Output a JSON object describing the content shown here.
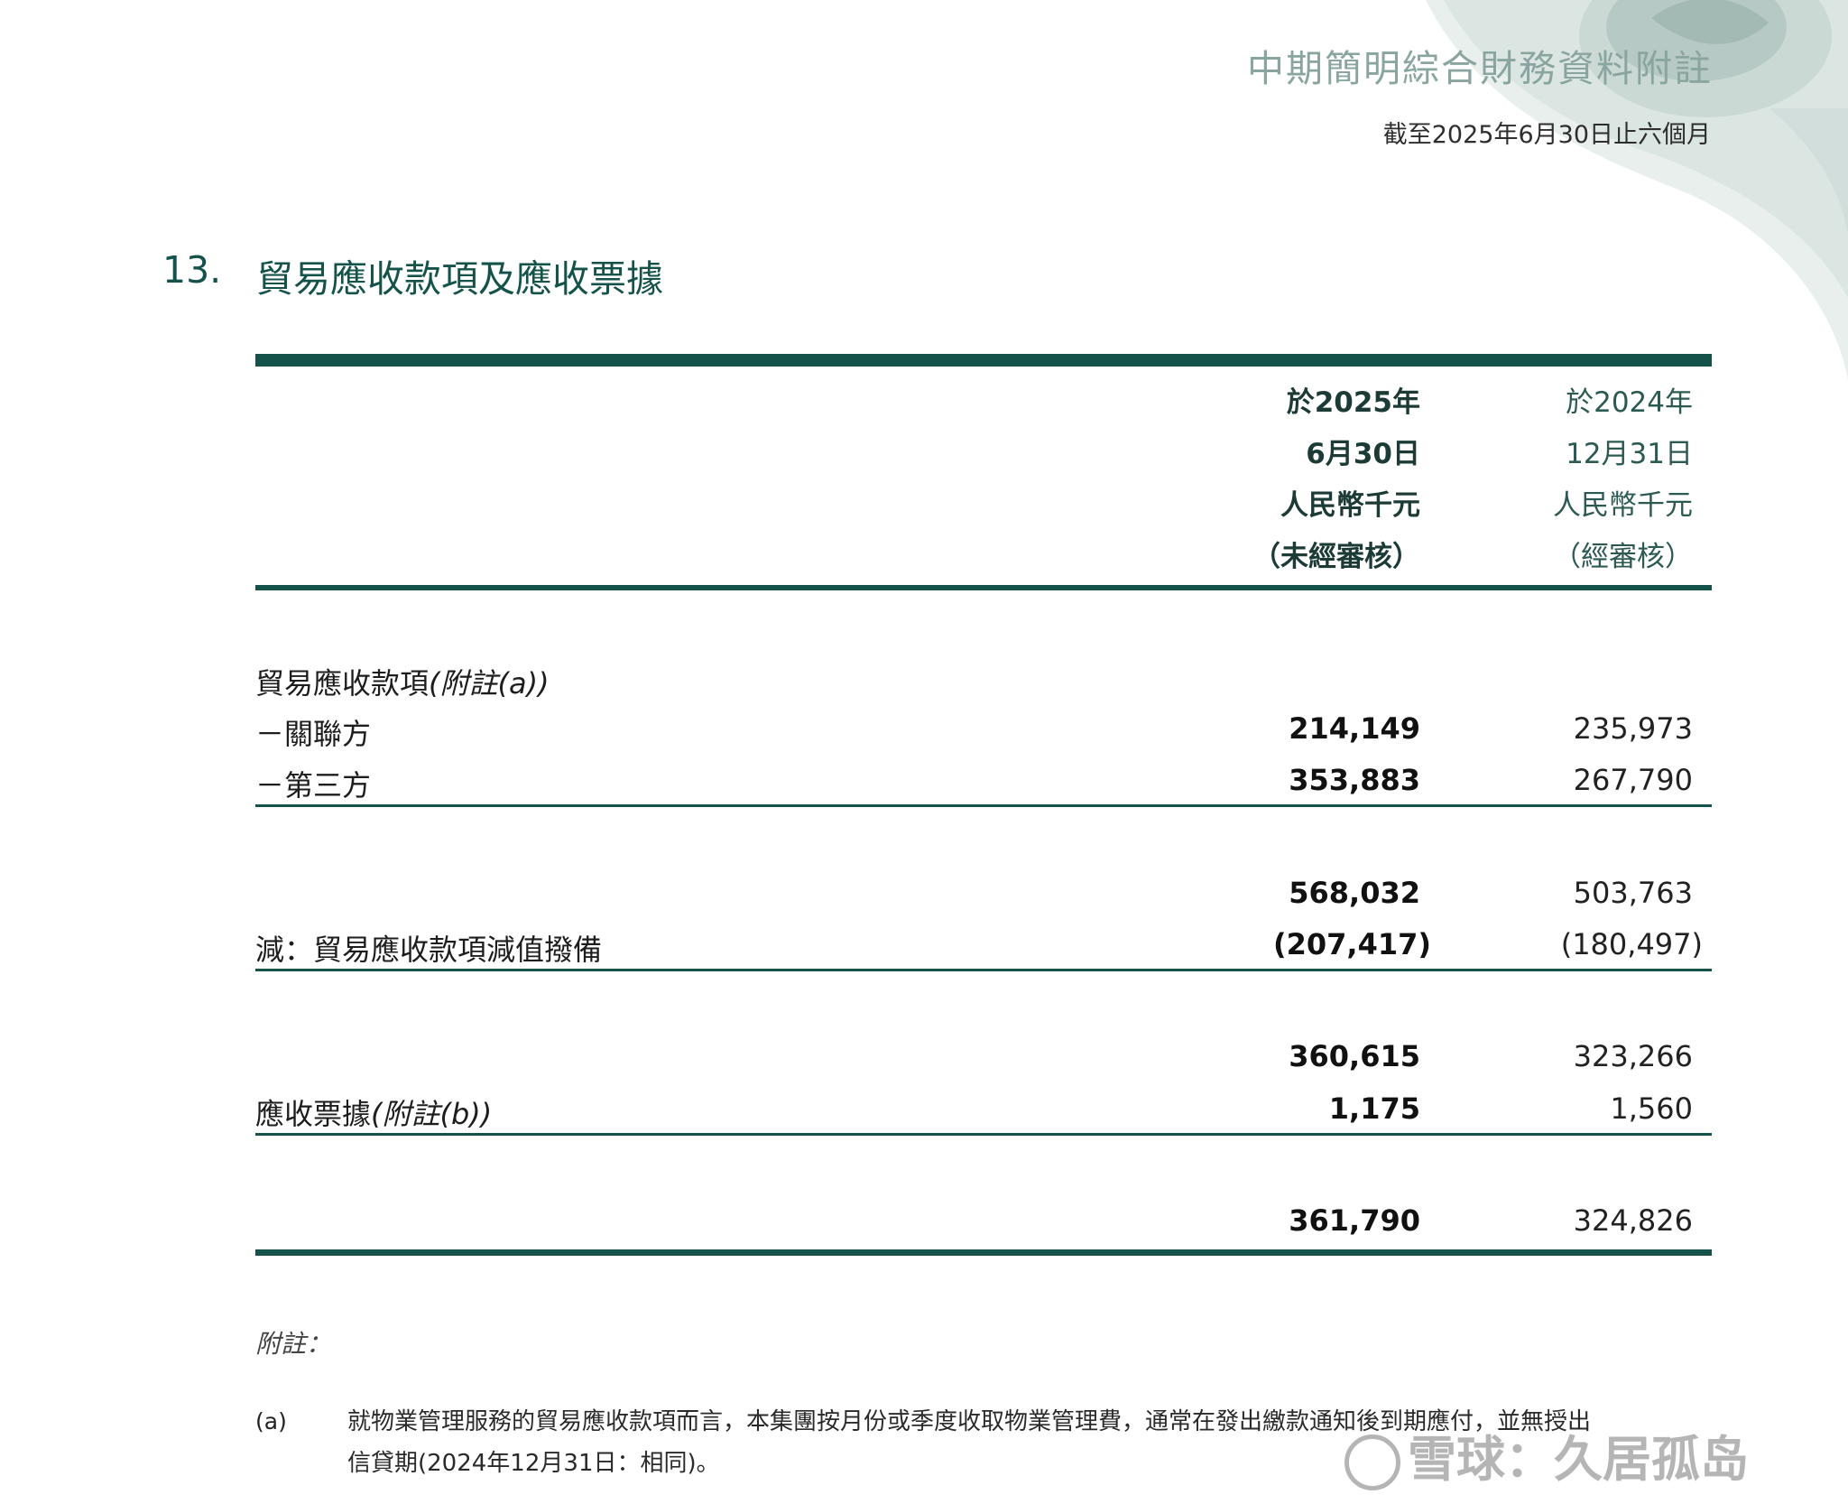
{
  "header": {
    "title": "中期簡明綜合財務資料附註",
    "subtitle": "截至2025年6月30日止六個月"
  },
  "section": {
    "number": "13.",
    "title": "貿易應收款項及應收票據"
  },
  "columns": {
    "current": {
      "line1": "於2025年",
      "line2": "6月30日",
      "line3": "人民幣千元",
      "line4": "（未經審核）"
    },
    "previous": {
      "line1": "於2024年",
      "line2": "12月31日",
      "line3": "人民幣千元",
      "line4": "（經審核）"
    }
  },
  "table": {
    "trade_receivables_label": "貿易應收款項",
    "trade_receivables_note": "(附註(a))",
    "related_party": {
      "label": "－關聯方",
      "current": "214,149",
      "previous": "235,973"
    },
    "third_party": {
      "label": "－第三方",
      "current": "353,883",
      "previous": "267,790"
    },
    "subtotal1": {
      "current": "568,032",
      "previous": "503,763"
    },
    "impairment": {
      "label": "減：貿易應收款項減值撥備",
      "current": "(207,417)",
      "previous": "(180,497)"
    },
    "subtotal2": {
      "current": "360,615",
      "previous": "323,266"
    },
    "notes_receivable": {
      "label": "應收票據",
      "note": "(附註(b))",
      "current": "1,175",
      "previous": "1,560"
    },
    "total": {
      "current": "361,790",
      "previous": "324,826"
    }
  },
  "notes": {
    "heading": "附註：",
    "a_label": "(a)",
    "a_line1": "就物業管理服務的貿易應收款項而言，本集團按月份或季度收取物業管理費，通常在發出繳款通知後到期應付，並無授出",
    "a_line2": "信貸期(2024年12月31日：相同)。"
  },
  "watermark": "雪球：久居孤岛",
  "colors": {
    "accent": "#14524a",
    "header_grey_green": "#8aa59f"
  }
}
